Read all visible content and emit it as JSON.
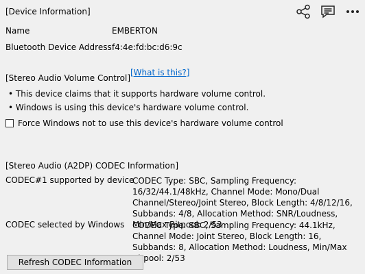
{
  "device_info": {
    "title": "[Device Information]",
    "name_label": "Name",
    "name_value": "EMBERTON",
    "address_label": "Bluetooth Device Address",
    "address_value": "f4:4e:fd:bc:d6:9c"
  },
  "toolbar": {
    "icons": [
      "share-icon",
      "feedback-icon",
      "more-icon"
    ]
  },
  "volume": {
    "title": "[Stereo Audio Volume Control]",
    "help_link": "[What is this?]",
    "bullet1": "• This device claims that it supports hardware volume control.",
    "bullet2": "• Windows is using this device's hardware volume control.",
    "checkbox_label": "Force Windows not to use this device's hardware volume control",
    "checkbox_checked": false
  },
  "codec": {
    "title": "[Stereo Audio (A2DP) CODEC Information]",
    "supported_label": "CODEC#1 supported by device",
    "supported_value": "CODEC Type: SBC, Sampling Frequency: 16/32/44.1/48kHz, Channel Mode: Mono/Dual Channel/Stereo/Joint Stereo, Block Length: 4/8/12/16, Subbands: 4/8, Allocation Method: SNR/Loudness, Min/Max Bitpool: 2/53",
    "selected_label": "CODEC selected by Windows",
    "selected_value": "CODEC Type: SBC, Sampling Frequency: 44.1kHz, Channel Mode: Joint Stereo, Block Length: 16, Subbands: 8, Allocation Method: Loudness, Min/Max Bitpool: 2/53",
    "refresh_button": "Refresh CODEC Information"
  }
}
